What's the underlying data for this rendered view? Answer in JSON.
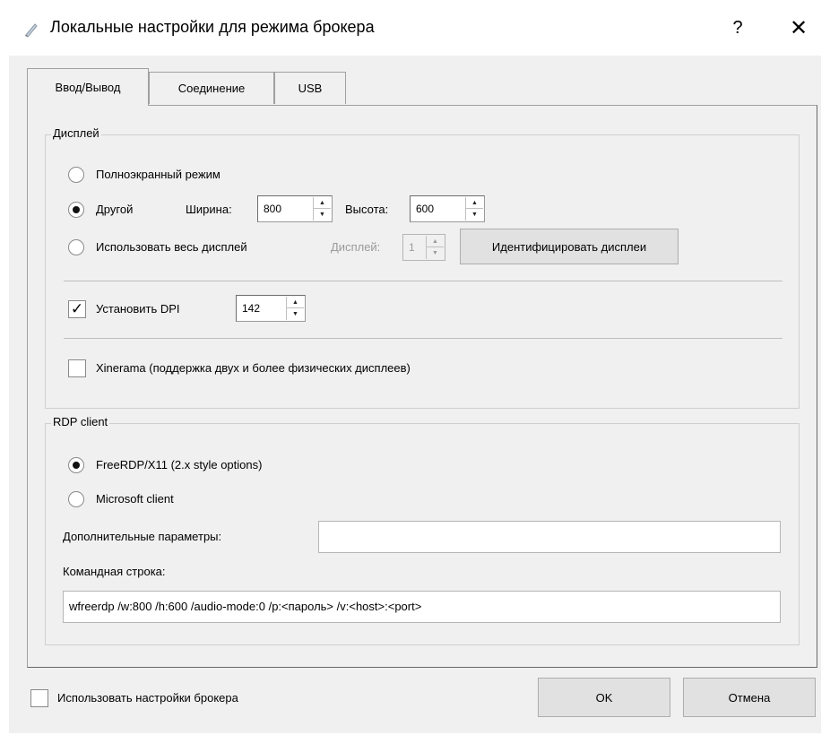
{
  "window": {
    "title": "Локальные настройки для режима брокера",
    "help": "?",
    "close": "✕"
  },
  "tabs": [
    {
      "label": "Ввод/Вывод",
      "active": true
    },
    {
      "label": "Соединение",
      "active": false
    },
    {
      "label": "USB",
      "active": false
    }
  ],
  "display": {
    "group_title": "Дисплей",
    "fullscreen_label": "Полноэкранный режим",
    "other_label": "Другой",
    "width_label": "Ширина:",
    "width_value": "800",
    "height_label": "Высота:",
    "height_value": "600",
    "all_displays_label": "Использовать весь дисплей",
    "display_label": "Дисплей:",
    "display_value": "1",
    "identify_button": "Идентифицировать дисплеи",
    "dpi_label": "Установить DPI",
    "dpi_checked": true,
    "dpi_value": "142",
    "xinerama_label": "Xinerama (поддержка двух и более физических дисплеев)",
    "xinerama_checked": false,
    "selected_mode": "other"
  },
  "rdp": {
    "group_title": "RDP client",
    "freerdp_label": "FreeRDP/X11 (2.x style options)",
    "microsoft_label": "Microsoft client",
    "selected": "freerdp",
    "extra_params_label": "Дополнительные параметры:",
    "extra_params_value": "",
    "cmdline_label": "Командная строка:",
    "cmdline_value": "wfreerdp  /w:800 /h:600 /audio-mode:0 /p:<пароль> /v:<host>:<port>"
  },
  "footer": {
    "use_broker_label": "Использовать настройки брокера",
    "use_broker_checked": false,
    "ok_label": "OK",
    "cancel_label": "Отмена"
  }
}
